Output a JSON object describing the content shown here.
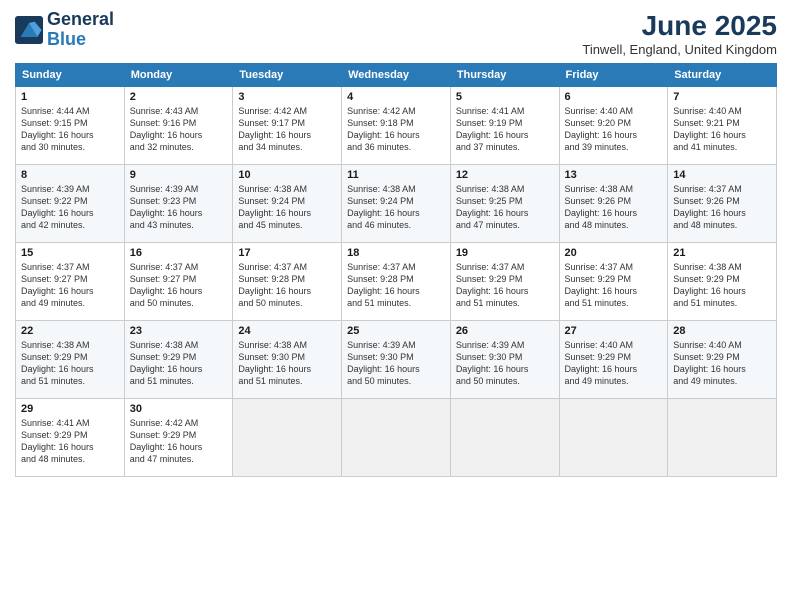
{
  "header": {
    "logo_line1": "General",
    "logo_line2": "Blue",
    "month_title": "June 2025",
    "location": "Tinwell, England, United Kingdom"
  },
  "weekdays": [
    "Sunday",
    "Monday",
    "Tuesday",
    "Wednesday",
    "Thursday",
    "Friday",
    "Saturday"
  ],
  "weeks": [
    [
      {
        "day": "1",
        "info": "Sunrise: 4:44 AM\nSunset: 9:15 PM\nDaylight: 16 hours\nand 30 minutes."
      },
      {
        "day": "2",
        "info": "Sunrise: 4:43 AM\nSunset: 9:16 PM\nDaylight: 16 hours\nand 32 minutes."
      },
      {
        "day": "3",
        "info": "Sunrise: 4:42 AM\nSunset: 9:17 PM\nDaylight: 16 hours\nand 34 minutes."
      },
      {
        "day": "4",
        "info": "Sunrise: 4:42 AM\nSunset: 9:18 PM\nDaylight: 16 hours\nand 36 minutes."
      },
      {
        "day": "5",
        "info": "Sunrise: 4:41 AM\nSunset: 9:19 PM\nDaylight: 16 hours\nand 37 minutes."
      },
      {
        "day": "6",
        "info": "Sunrise: 4:40 AM\nSunset: 9:20 PM\nDaylight: 16 hours\nand 39 minutes."
      },
      {
        "day": "7",
        "info": "Sunrise: 4:40 AM\nSunset: 9:21 PM\nDaylight: 16 hours\nand 41 minutes."
      }
    ],
    [
      {
        "day": "8",
        "info": "Sunrise: 4:39 AM\nSunset: 9:22 PM\nDaylight: 16 hours\nand 42 minutes."
      },
      {
        "day": "9",
        "info": "Sunrise: 4:39 AM\nSunset: 9:23 PM\nDaylight: 16 hours\nand 43 minutes."
      },
      {
        "day": "10",
        "info": "Sunrise: 4:38 AM\nSunset: 9:24 PM\nDaylight: 16 hours\nand 45 minutes."
      },
      {
        "day": "11",
        "info": "Sunrise: 4:38 AM\nSunset: 9:24 PM\nDaylight: 16 hours\nand 46 minutes."
      },
      {
        "day": "12",
        "info": "Sunrise: 4:38 AM\nSunset: 9:25 PM\nDaylight: 16 hours\nand 47 minutes."
      },
      {
        "day": "13",
        "info": "Sunrise: 4:38 AM\nSunset: 9:26 PM\nDaylight: 16 hours\nand 48 minutes."
      },
      {
        "day": "14",
        "info": "Sunrise: 4:37 AM\nSunset: 9:26 PM\nDaylight: 16 hours\nand 48 minutes."
      }
    ],
    [
      {
        "day": "15",
        "info": "Sunrise: 4:37 AM\nSunset: 9:27 PM\nDaylight: 16 hours\nand 49 minutes."
      },
      {
        "day": "16",
        "info": "Sunrise: 4:37 AM\nSunset: 9:27 PM\nDaylight: 16 hours\nand 50 minutes."
      },
      {
        "day": "17",
        "info": "Sunrise: 4:37 AM\nSunset: 9:28 PM\nDaylight: 16 hours\nand 50 minutes."
      },
      {
        "day": "18",
        "info": "Sunrise: 4:37 AM\nSunset: 9:28 PM\nDaylight: 16 hours\nand 51 minutes."
      },
      {
        "day": "19",
        "info": "Sunrise: 4:37 AM\nSunset: 9:29 PM\nDaylight: 16 hours\nand 51 minutes."
      },
      {
        "day": "20",
        "info": "Sunrise: 4:37 AM\nSunset: 9:29 PM\nDaylight: 16 hours\nand 51 minutes."
      },
      {
        "day": "21",
        "info": "Sunrise: 4:38 AM\nSunset: 9:29 PM\nDaylight: 16 hours\nand 51 minutes."
      }
    ],
    [
      {
        "day": "22",
        "info": "Sunrise: 4:38 AM\nSunset: 9:29 PM\nDaylight: 16 hours\nand 51 minutes."
      },
      {
        "day": "23",
        "info": "Sunrise: 4:38 AM\nSunset: 9:29 PM\nDaylight: 16 hours\nand 51 minutes."
      },
      {
        "day": "24",
        "info": "Sunrise: 4:38 AM\nSunset: 9:30 PM\nDaylight: 16 hours\nand 51 minutes."
      },
      {
        "day": "25",
        "info": "Sunrise: 4:39 AM\nSunset: 9:30 PM\nDaylight: 16 hours\nand 50 minutes."
      },
      {
        "day": "26",
        "info": "Sunrise: 4:39 AM\nSunset: 9:30 PM\nDaylight: 16 hours\nand 50 minutes."
      },
      {
        "day": "27",
        "info": "Sunrise: 4:40 AM\nSunset: 9:29 PM\nDaylight: 16 hours\nand 49 minutes."
      },
      {
        "day": "28",
        "info": "Sunrise: 4:40 AM\nSunset: 9:29 PM\nDaylight: 16 hours\nand 49 minutes."
      }
    ],
    [
      {
        "day": "29",
        "info": "Sunrise: 4:41 AM\nSunset: 9:29 PM\nDaylight: 16 hours\nand 48 minutes."
      },
      {
        "day": "30",
        "info": "Sunrise: 4:42 AM\nSunset: 9:29 PM\nDaylight: 16 hours\nand 47 minutes."
      },
      {
        "day": "",
        "info": ""
      },
      {
        "day": "",
        "info": ""
      },
      {
        "day": "",
        "info": ""
      },
      {
        "day": "",
        "info": ""
      },
      {
        "day": "",
        "info": ""
      }
    ]
  ]
}
